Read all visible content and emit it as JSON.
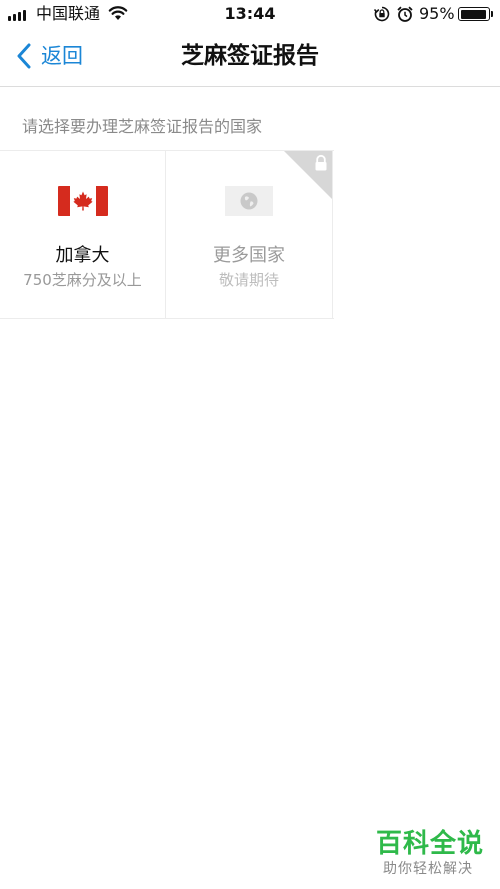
{
  "status_bar": {
    "carrier": "中国联通",
    "time": "13:44",
    "battery_percent": "95%",
    "battery_level": 0.95,
    "icons": [
      "signal-icon",
      "wifi-icon",
      "rotation-lock-icon",
      "alarm-icon",
      "battery-icon"
    ]
  },
  "nav": {
    "back_label": "返回",
    "title": "芝麻签证报告",
    "back_icon": "chevron-left-icon"
  },
  "prompt": "请选择要办理芝麻签证报告的国家",
  "countries": [
    {
      "name": "加拿大",
      "subtitle": "750芝麻分及以上",
      "icon": "canada-flag-icon",
      "locked": false
    },
    {
      "name": "更多国家",
      "subtitle": "敬请期待",
      "icon": "globe-icon",
      "locked": true
    }
  ],
  "watermark": {
    "title": "百科全说",
    "subtitle": "助你轻松解决"
  },
  "colors": {
    "accent": "#1b86d6",
    "flag_red": "#d52b1e",
    "watermark_green": "#2fb94a",
    "muted_text": "#999999"
  }
}
